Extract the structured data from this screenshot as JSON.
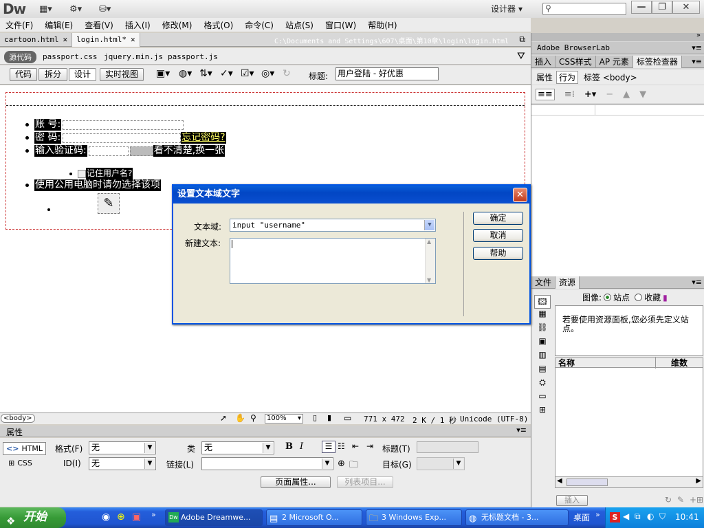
{
  "app": {
    "logo": "Dw",
    "workspace": "设计器",
    "window_controls": [
      "—",
      "❐",
      "✕"
    ]
  },
  "menu": [
    "文件(F)",
    "编辑(E)",
    "查看(V)",
    "插入(I)",
    "修改(M)",
    "格式(O)",
    "命令(C)",
    "站点(S)",
    "窗口(W)",
    "帮助(H)"
  ],
  "doc_tabs": [
    {
      "label": "cartoon.html",
      "active": false
    },
    {
      "label": "login.html*",
      "active": true
    }
  ],
  "doc_path": "C:\\Documents and Settings\\607\\桌面\\第10章\\login\\login.html",
  "related_files": {
    "source_badge": "源代码",
    "files": [
      "passport.css",
      "jquery.min.js",
      "passport.js"
    ]
  },
  "doc_toolbar": {
    "views": [
      "代码",
      "拆分",
      "设计",
      "实时视图"
    ],
    "active_view": "设计",
    "title_label": "标题:",
    "title_value": "用户登陆 - 好优惠"
  },
  "design": {
    "account_label": "账  号:",
    "password_label": "密  码:",
    "forgot_link": "忘记密码?",
    "captcha_label": "输入验证码:",
    "captcha_refresh": "看不清楚,换一张",
    "remember_label": "记住用户名?",
    "public_pc_warning": "使用公用电脑时请勿选择该项"
  },
  "status_bar": {
    "tag": "<body>",
    "zoom": "100%",
    "dimensions": "771 x 472",
    "size": "2 K / 1 秒",
    "encoding": "Unicode (UTF-8)"
  },
  "properties": {
    "header": "属性",
    "html_btn": "HTML",
    "css_btn": "CSS",
    "format_label": "格式(F)",
    "format_value": "无",
    "class_label": "类",
    "class_value": "无",
    "id_label": "ID(I)",
    "id_value": "无",
    "link_label": "链接(L)",
    "link_value": "",
    "title_label": "标题(T)",
    "target_label": "目标(G)",
    "bold": "B",
    "italic": "I",
    "page_props_btn": "页面属性...",
    "list_item_btn": "列表项目..."
  },
  "right_panel": {
    "browserlab": "Adobe BrowserLab",
    "insert_tabs": [
      "插入",
      "CSS样式",
      "AP 元素",
      "标签检查器"
    ],
    "active_insert_tab": "标签检查器",
    "inspector_tabs": [
      "属性",
      "行为"
    ],
    "active_inspector_tab": "行为",
    "tag_label": "标签 <body>",
    "files_tabs": [
      "文件",
      "资源"
    ],
    "active_files_tab": "资源",
    "images_label": "图像:",
    "site_radio": "站点",
    "favorites_radio": "收藏",
    "assets_message": "若要使用资源面板,您必须先定义站点。",
    "col_name": "名称",
    "col_dims": "维数",
    "insert_btn": "插入"
  },
  "dialog": {
    "title": "设置文本域文字",
    "textfield_label": "文本域:",
    "textfield_value": "input \"username\"",
    "newtext_label": "新建文本:",
    "newtext_value": "",
    "ok": "确定",
    "cancel": "取消",
    "help": "帮助"
  },
  "taskbar": {
    "start": "开始",
    "tasks": [
      {
        "label": "Adobe Dreamwe...",
        "active": true
      },
      {
        "label": "2 Microsoft O...",
        "active": false
      },
      {
        "label": "3 Windows Exp...",
        "active": false
      },
      {
        "label": "无标题文档 - 3...",
        "active": false
      }
    ],
    "desktop": "桌面",
    "clock": "10:41"
  }
}
